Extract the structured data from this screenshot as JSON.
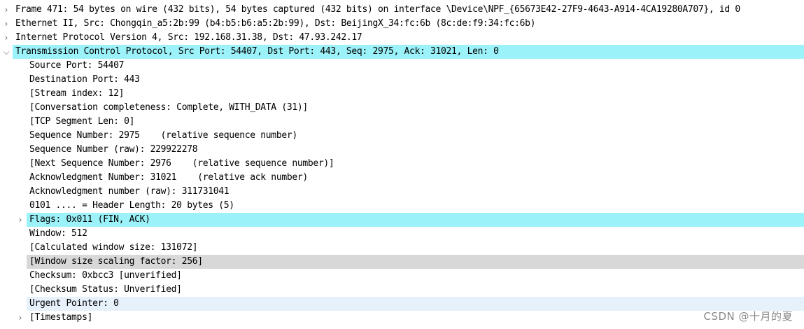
{
  "icons": {
    "collapsed": "chevron-right-icon",
    "expanded": "chevron-down-icon"
  },
  "colors": {
    "selected_row": "#9cf2f9",
    "secondary_highlight": "#d8d8d8",
    "hover_row": "#e6f1fb"
  },
  "tree": {
    "frame": "Frame 471: 54 bytes on wire (432 bits), 54 bytes captured (432 bits) on interface \\Device\\NPF_{65673E42-27F9-4643-A914-4CA19280A707}, id 0",
    "ethernet": "Ethernet II, Src: Chongqin_a5:2b:99 (b4:b5:b6:a5:2b:99), Dst: BeijingX_34:fc:6b (8c:de:f9:34:fc:6b)",
    "ipv4": "Internet Protocol Version 4, Src: 192.168.31.38, Dst: 47.93.242.17",
    "tcp": "Transmission Control Protocol, Src Port: 54407, Dst Port: 443, Seq: 2975, Ack: 31021, Len: 0",
    "tcp_fields": {
      "src_port": "Source Port: 54407",
      "dst_port": "Destination Port: 443",
      "stream_index": "[Stream index: 12]",
      "conversation": "[Conversation completeness: Complete, WITH_DATA (31)]",
      "segment_len": "[TCP Segment Len: 0]",
      "seq": "Sequence Number: 2975    (relative sequence number)",
      "seq_raw": "Sequence Number (raw): 229922278",
      "next_seq": "[Next Sequence Number: 2976    (relative sequence number)]",
      "ack": "Acknowledgment Number: 31021    (relative ack number)",
      "ack_raw": "Acknowledgment number (raw): 311731041",
      "header_len": "0101 .... = Header Length: 20 bytes (5)",
      "flags": "Flags: 0x011 (FIN, ACK)",
      "window": "Window: 512",
      "calc_window": "[Calculated window size: 131072]",
      "window_scaling": "[Window size scaling factor: 256]",
      "checksum": "Checksum: 0xbcc3 [unverified]",
      "checksum_status": "[Checksum Status: Unverified]",
      "urgent_pointer": "Urgent Pointer: 0",
      "timestamps": "[Timestamps]"
    }
  },
  "watermark": "CSDN @十月的夏"
}
